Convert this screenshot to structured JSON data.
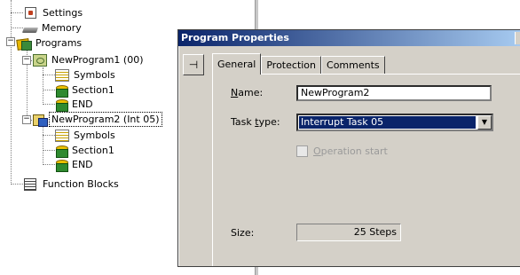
{
  "tree": {
    "items": [
      {
        "label": "Settings",
        "icon": "settings-icon"
      },
      {
        "label": "Memory",
        "icon": "memory-icon"
      },
      {
        "label": "Programs",
        "icon": "programs-icon",
        "expanded": true
      },
      {
        "label": "NewProgram1 (00)",
        "icon": "program-icon",
        "expanded": true
      },
      {
        "label": "Symbols",
        "icon": "symbols-icon"
      },
      {
        "label": "Section1",
        "icon": "section-icon"
      },
      {
        "label": "END",
        "icon": "end-section-icon"
      },
      {
        "label": "NewProgram2 (Int 05)",
        "icon": "interrupt-program-icon",
        "expanded": true,
        "selected": true
      },
      {
        "label": "Symbols",
        "icon": "symbols-icon"
      },
      {
        "label": "Section1",
        "icon": "section-icon"
      },
      {
        "label": "END",
        "icon": "end-section-icon"
      },
      {
        "label": "Function Blocks",
        "icon": "function-blocks-icon"
      }
    ],
    "expander_minus": "−"
  },
  "dialog": {
    "title": "Program Properties",
    "pin_glyph": "⊣",
    "tabs": [
      {
        "label": "General",
        "active": true
      },
      {
        "label": "Protection",
        "active": false
      },
      {
        "label": "Comments",
        "active": false
      }
    ],
    "general": {
      "name_label_u": "N",
      "name_label_rest": "ame:",
      "name_value": "NewProgram2",
      "task_label_pre": "Task ",
      "task_label_u": "t",
      "task_label_rest": "ype:",
      "task_value": "Interrupt Task 05",
      "task_arrow": "▼",
      "operation_start_label_pre": "",
      "operation_start_label_u": "O",
      "operation_start_label_rest": "peration start",
      "operation_start_checked": false,
      "operation_start_enabled": false,
      "size_label": "Size:",
      "size_value": "25 Steps"
    }
  },
  "colors": {
    "titlebar_start": "#0a246a",
    "titlebar_end": "#a6caf0",
    "dialog_face": "#d4d0c8",
    "selection": "#0a246a"
  }
}
